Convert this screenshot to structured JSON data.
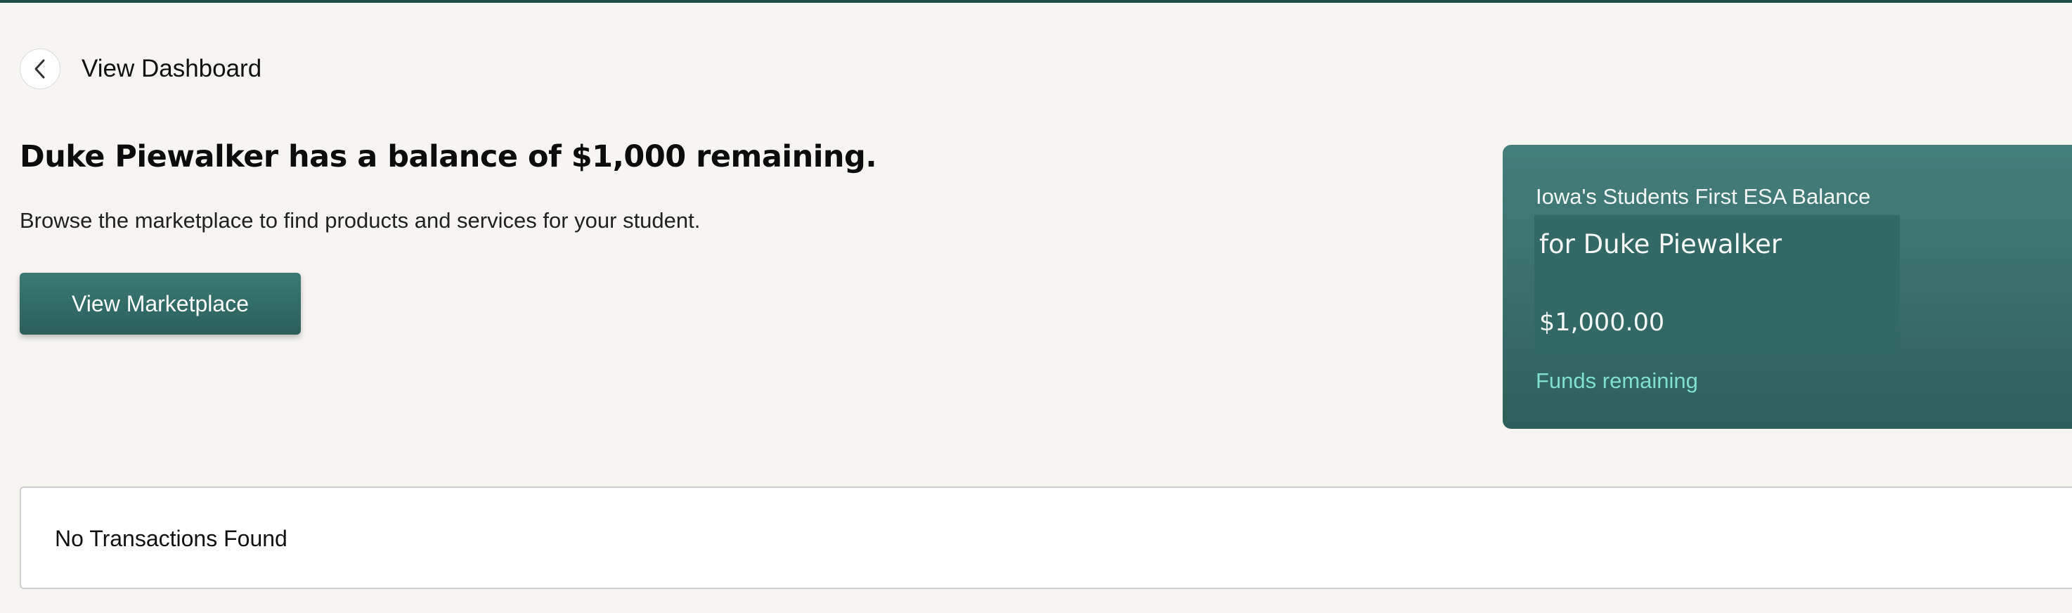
{
  "nav": {
    "back_label": "View Dashboard",
    "back_icon": "chevron-left-icon"
  },
  "hero": {
    "headline": "Duke Piewalker has a balance of $1,000 remaining.",
    "subtext": "Browse the marketplace to find products and services for your student.",
    "cta_label": "View Marketplace"
  },
  "balance_card": {
    "title": "Iowa's Students First ESA Balance",
    "for_student": "for Duke Piewalker",
    "amount": "$1,000.00",
    "remaining_label": "Funds remaining"
  },
  "transactions": {
    "empty_message": "No Transactions Found"
  },
  "colors": {
    "page_background": "#f6f5f2",
    "accent": "#2f6560",
    "card_gradient_top": "#457f7a",
    "card_gradient_bottom": "#2f5f5b",
    "funds_remaining_text": "#7fe0cb"
  }
}
